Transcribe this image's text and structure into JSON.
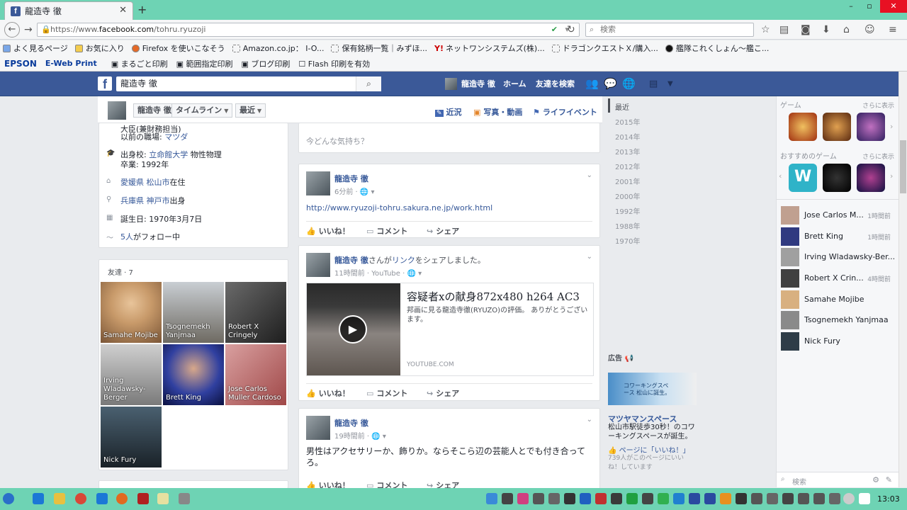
{
  "browser": {
    "tab_title": "龍造寺 徹",
    "tab_close": "✕",
    "new_tab": "+",
    "url_prefix": "https://www.",
    "url_domain": "facebook.com",
    "url_path": "/tohru.ryuzoji",
    "search_placeholder": "検索",
    "win_min": "–",
    "win_max": "▫",
    "win_close": "✕"
  },
  "bookmarks": [
    "よく見るページ",
    "お気に入り",
    "Firefox を使いこなそう",
    "Amazon.co.jp： I-O...",
    "保有銘柄一覧｜みずほ...",
    "ネットワンシステムズ(株)...",
    "ドラゴンクエストＸ/購入...",
    "艦隊これくしょん～艦こ..."
  ],
  "epson": {
    "brand": "EPSON",
    "eweb": "E-Web Print",
    "b1": "まるごと印刷",
    "b2": "範囲指定印刷",
    "b3": "ブログ印刷",
    "b4": "Flash 印刷を有効"
  },
  "fb": {
    "logo": "f",
    "search_value": "龍造寺 徹",
    "profile_name": "龍造寺 徹",
    "home": "ホーム",
    "find_friends": "友達を検索"
  },
  "subhead": {
    "name": "龍造寺 徹",
    "timeline": "タイムライン",
    "recent": "最近",
    "link1": "近況",
    "link2": "写真・動画",
    "link3": "ライフイベント"
  },
  "about": {
    "top_partial": "大臣(兼財務担当)",
    "prev_work_label": "以前の職場: ",
    "prev_work": "マツダ",
    "school_label": "出身校: ",
    "school": "立命館大学",
    "school_field": " 物性物理",
    "grad": "卒業: 1992年",
    "live_pref": "愛媛県",
    "live_city": "松山市",
    "live_suffix": "在住",
    "from_pref": "兵庫県",
    "from_city": "神戸市",
    "from_suffix": "出身",
    "birthday": "誕生日: 1970年3月7日",
    "followers_link": "5人",
    "followers_suffix": "がフォロー中"
  },
  "friends": {
    "title": "友達 · 7",
    "list": [
      {
        "name": "Samahe Mojibe",
        "color": "#c89a6a"
      },
      {
        "name": "Tsognemekh Yanjmaa",
        "color": "#8b9096"
      },
      {
        "name": "Robert X Cringely",
        "color": "#3e3e3e"
      },
      {
        "name": "Irving Wladawsky-Berger",
        "color": "#9c9c9c"
      },
      {
        "name": "Brett King",
        "color": "#1a2a6c"
      },
      {
        "name": "Jose Carlos Muller Cardoso",
        "color": "#b86a6a"
      },
      {
        "name": "Nick Fury",
        "color": "#2e3c48"
      }
    ]
  },
  "composer": {
    "placeholder": "今どんな気持ち？"
  },
  "posts": [
    {
      "name": "龍造寺 徹",
      "meta": "6分前 · 🌐 ▾",
      "body": "http://www.ryuzoji-tohru.sakura.ne.jp/work.html"
    },
    {
      "name": "龍造寺 徹",
      "name_suffix": "さんが",
      "link_word": "リンク",
      "name_suffix2": "をシェアしました。",
      "meta": "11時間前 · YouTube · 🌐 ▾",
      "video_title": "容疑者xの献身872x480 h264 AC3",
      "video_desc": "邦画に見る龍造寺徹(RYUZO)の評価。 ありがとうございます。",
      "video_source": "YOUTUBE.COM"
    },
    {
      "name": "龍造寺 徹",
      "meta": "19時間前 · 🌐 ▾",
      "body": "男性はアクセサリーか、飾りか。ならそこら辺の芸能人とでも付き合ってろ。"
    }
  ],
  "actions": {
    "like": "いいね！",
    "comment": "コメント",
    "share": "シェア"
  },
  "years": [
    "最近",
    "2015年",
    "2014年",
    "2013年",
    "2012年",
    "2001年",
    "2000年",
    "1992年",
    "1988年",
    "1970年"
  ],
  "ad": {
    "label": "広告",
    "title": "マツヤマンスペース",
    "desc": "松山市駅徒歩30秒！のコワーキングスペースが誕生。",
    "like_prefix": "ページに「",
    "like_word": "いいね！",
    "like_suffix": "」",
    "count": "739人がこのページにいいね！しています",
    "img_text": "コワーキングスペース 松山に誕生。"
  },
  "right": {
    "games_title": "ゲーム",
    "games_more": "さらに表示",
    "rec_title": "おすすめのゲーム",
    "rec_more": "さらに表示",
    "chat": [
      {
        "name": "Jose Carlos M...",
        "time": "1時間前"
      },
      {
        "name": "Brett King",
        "time": "1時間前"
      },
      {
        "name": "Irving Wladawsky-Ber...",
        "time": ""
      },
      {
        "name": "Robert X Crin...",
        "time": "4時間前"
      },
      {
        "name": "Samahe Mojibe",
        "time": ""
      },
      {
        "name": "Tsognemekh Yanjmaa",
        "time": ""
      },
      {
        "name": "Nick Fury",
        "time": ""
      }
    ],
    "chat_search": "検索"
  },
  "taskbar": {
    "time": "13:03"
  }
}
